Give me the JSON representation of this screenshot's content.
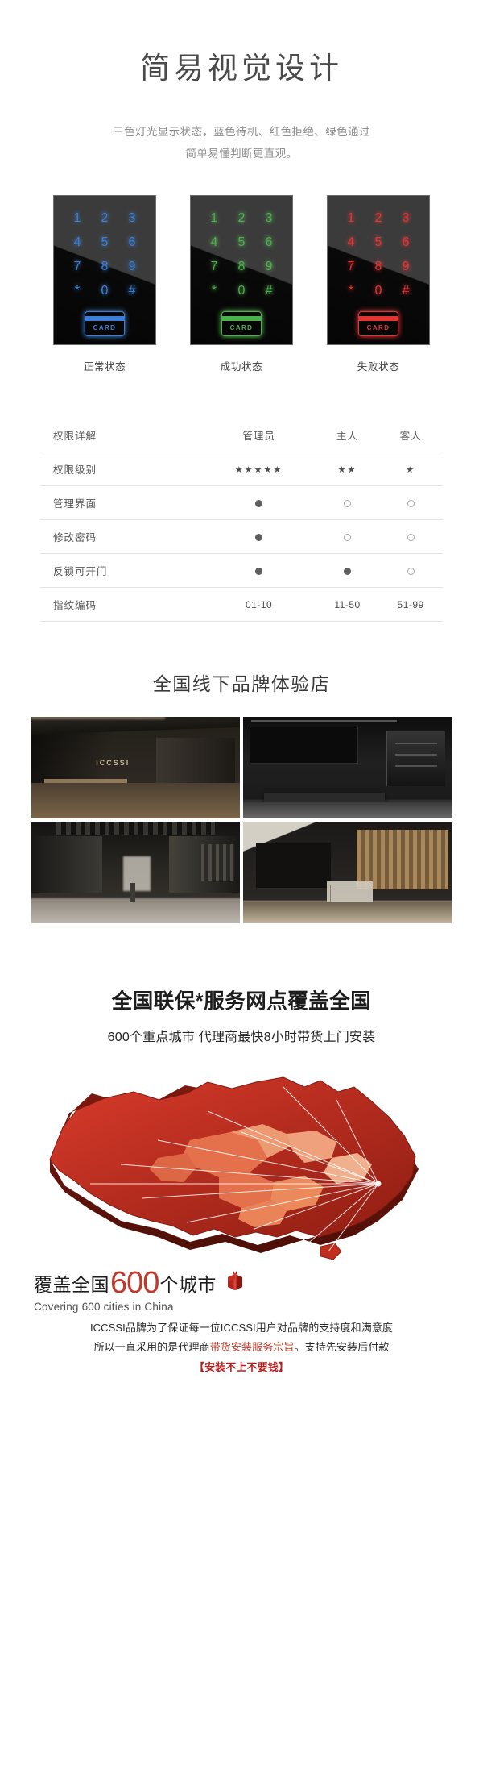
{
  "section_design": {
    "title": "简易视觉设计",
    "description_line1": "三色灯光显示状态，蓝色待机、红色拒绝、绿色通过",
    "description_line2": "简单易懂判断更直观。"
  },
  "keypads": {
    "keys": [
      "1",
      "2",
      "3",
      "4",
      "5",
      "6",
      "7",
      "8",
      "9",
      "*",
      "0",
      "#"
    ],
    "card_label": "CARD",
    "panels": [
      {
        "state_label": "正常状态",
        "color": "#3d7fd6",
        "glow": "#4a90e2"
      },
      {
        "state_label": "成功状态",
        "color": "#4caf50",
        "glow": "#6fdb63"
      },
      {
        "state_label": "失败状态",
        "color": "#e03535",
        "glow": "#ff4242"
      }
    ]
  },
  "permission_table": {
    "headers": [
      "权限详解",
      "管理员",
      "主人",
      "客人"
    ],
    "rows": [
      {
        "label": "权限级别",
        "type": "stars",
        "values": [
          "★★★★★",
          "★★",
          "★"
        ]
      },
      {
        "label": "管理界面",
        "type": "dots",
        "values": [
          "filled",
          "empty",
          "empty"
        ]
      },
      {
        "label": "修改密码",
        "type": "dots",
        "values": [
          "filled",
          "empty",
          "empty"
        ]
      },
      {
        "label": "反锁可开门",
        "type": "dots",
        "values": [
          "filled",
          "filled",
          "empty"
        ]
      },
      {
        "label": "指纹编码",
        "type": "text",
        "values": [
          "01-10",
          "11-50",
          "51-99"
        ]
      }
    ]
  },
  "stores": {
    "heading": "全国线下品牌体验店",
    "photos": [
      {
        "caption": "showroom-corridor-warm-lighting",
        "brand_text": "ICCSSI"
      },
      {
        "caption": "dark-product-display-wall"
      },
      {
        "caption": "long-corridor-perspective"
      },
      {
        "caption": "wood-slat-wall-display-case"
      }
    ]
  },
  "service": {
    "heading": "全国联保*服务网点覆盖全国",
    "subheading": "600个重点城市 代理商最快8小时带货上门安装",
    "map_accent": "#c0392b",
    "map_accent_light": "#e8744f"
  },
  "coverage": {
    "prefix": "覆盖全国",
    "count": "600",
    "suffix": "个城市",
    "english": "Covering 600 cities in China",
    "paragraph_line1": "ICCSSI品牌为了保证每一位ICCSSI用户对品牌的支持度和满意度",
    "paragraph_line2_pre": "所以一直采用的是代理商",
    "paragraph_line2_red": "带货安装服务宗旨",
    "paragraph_line2_post": "。支持先安装后付款",
    "paragraph_line3": "【安装不上不要钱】",
    "red_hex": "#c0392b"
  }
}
